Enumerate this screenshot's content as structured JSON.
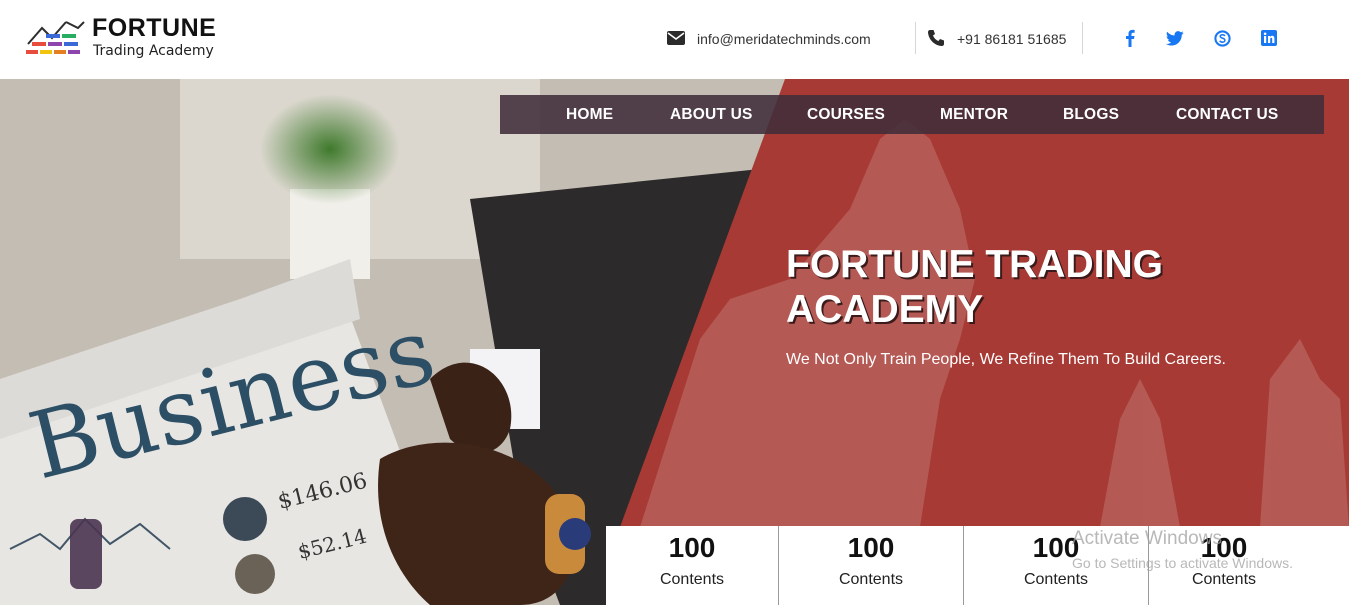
{
  "logo": {
    "title": "FORTUNE",
    "subtitle": "Trading Academy"
  },
  "contact": {
    "email": "info@meridatechminds.com",
    "phone": "+91 86181 51685"
  },
  "social": [
    "facebook-icon",
    "twitter-icon",
    "skype-icon",
    "linkedin-icon"
  ],
  "colors": {
    "brand_blue": "#1877f2",
    "hero_red": "#a73a34",
    "nav_bg": "#402e3a"
  },
  "nav": {
    "items": [
      "HOME",
      "ABOUT US",
      "COURSES",
      "MENTOR",
      "BLOGS",
      "CONTACT US"
    ]
  },
  "hero": {
    "title": "FORTUNE TRADING ACADEMY",
    "subtitle": "We Not Only Train People, We Refine Them To Build Careers."
  },
  "stats": [
    {
      "value": "100",
      "label": "Contents"
    },
    {
      "value": "100",
      "label": "Contents"
    },
    {
      "value": "100",
      "label": "Contents"
    },
    {
      "value": "100",
      "label": "Contents"
    }
  ],
  "watermark": {
    "line1": "Activate Windows",
    "line2": "Go to Settings to activate Windows."
  }
}
